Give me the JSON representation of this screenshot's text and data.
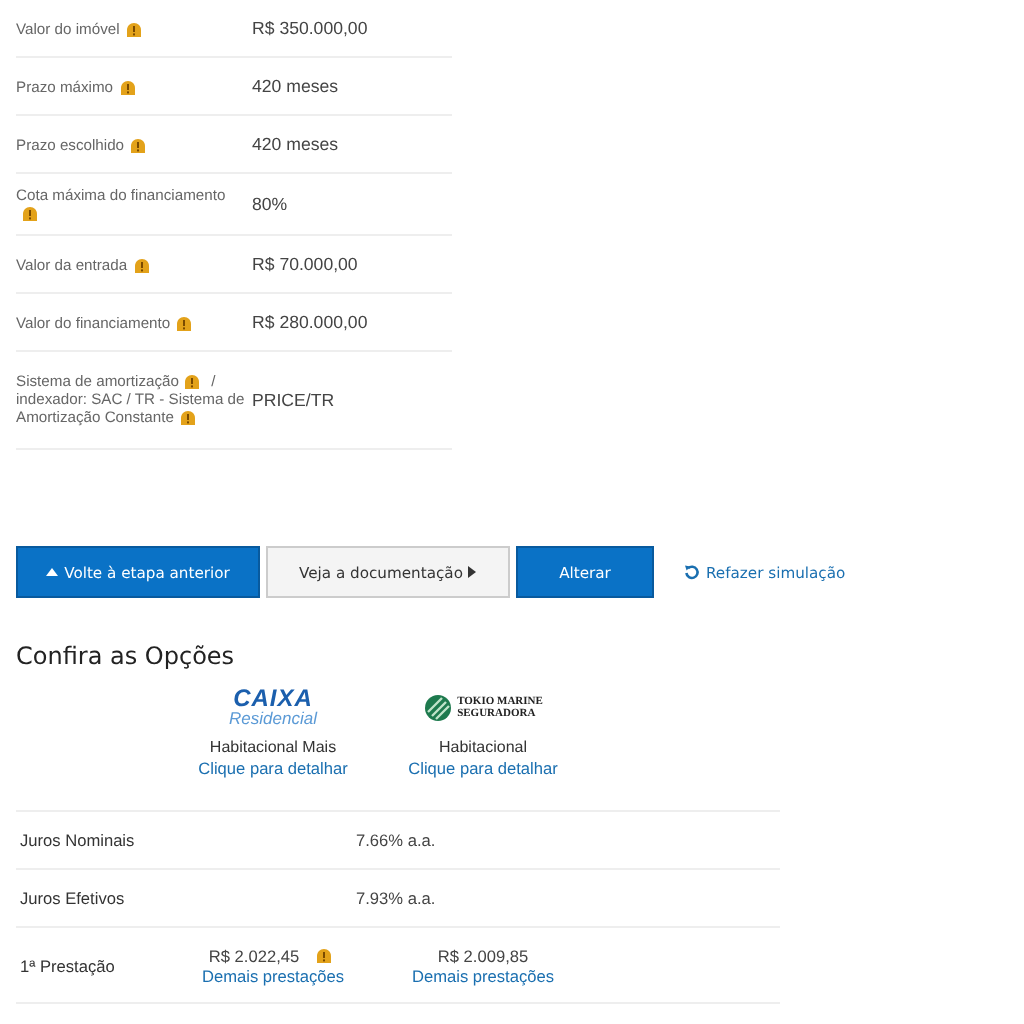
{
  "summary": [
    {
      "label_parts": [
        {
          "text": "Valor do imóvel",
          "info": true
        }
      ],
      "value": "R$ 350.000,00"
    },
    {
      "label_parts": [
        {
          "text": "Prazo máximo",
          "info": true
        }
      ],
      "value": "420 meses"
    },
    {
      "label_parts": [
        {
          "text": "Prazo escolhido",
          "info": true
        }
      ],
      "value": "420 meses"
    },
    {
      "label_parts": [
        {
          "text": "Cota máxima do financiamento",
          "info": true
        }
      ],
      "value": "80%"
    },
    {
      "label_parts": [
        {
          "text": "Valor da entrada",
          "info": true
        }
      ],
      "value": "R$ 70.000,00"
    },
    {
      "label_parts": [
        {
          "text": "Valor do financiamento",
          "info": true
        }
      ],
      "value": "R$ 280.000,00"
    },
    {
      "label_parts": [
        {
          "text": "Sistema de amortização",
          "info": true
        },
        {
          "text": "/ indexador: SAC / TR - Sistema de Amortização Constante",
          "info": true
        }
      ],
      "value": "PRICE/TR"
    }
  ],
  "actions": [
    {
      "kind": "back",
      "label": "Volte à etapa anterior"
    },
    {
      "kind": "forward",
      "label": "Veja a documentação"
    },
    {
      "kind": "primary",
      "label": "Alterar"
    },
    {
      "kind": "restart",
      "label": "Refazer simulação"
    }
  ],
  "options_heading": "Confira as Opções",
  "options": [
    {
      "kind": "bank",
      "logo_text": [
        "CAIXA",
        "Residencial"
      ],
      "name": "Habitacional Mais",
      "link": "Clique para detalhar"
    },
    {
      "kind": "insurer",
      "logo_text": [
        "TOKIO MARINE",
        "SEGURADORA"
      ],
      "name": "Habitacional",
      "link": "Clique para detalhar"
    }
  ],
  "comparison": [
    {
      "kind": "shared",
      "label": "Juros Nominais",
      "value": "7.66% a.a."
    },
    {
      "kind": "shared",
      "label": "Juros Efetivos",
      "value": "7.93% a.a."
    },
    {
      "kind": "per_option",
      "label": "1ª Prestação",
      "cells": [
        {
          "value": "R$ 2.022,45",
          "info": true,
          "link": "Demais prestações"
        },
        {
          "value": "R$ 2.009,85",
          "info": false,
          "link": "Demais prestações"
        }
      ]
    }
  ]
}
